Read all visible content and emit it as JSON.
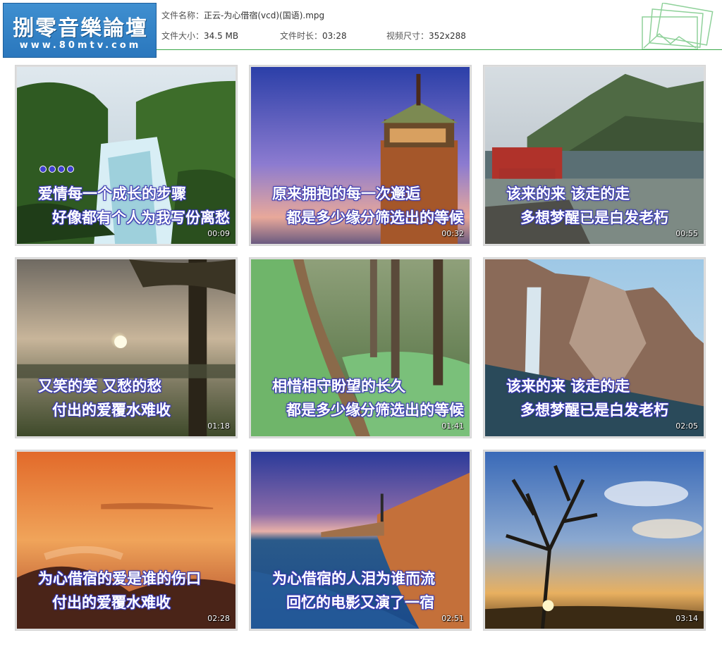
{
  "header": {
    "logo_title": "捌零音樂論壇",
    "logo_url": "www.80mtv.com",
    "file_name_label": "文件名称：",
    "file_name": "正云-为心借宿(vcd)(国语).mpg",
    "file_size_label": "文件大小：",
    "file_size": "34.5 MB",
    "duration_label": "文件时长：",
    "duration": "03:28",
    "resolution_label": "视频尺寸：",
    "resolution": "352x288",
    "accent_color": "#3aa84a"
  },
  "thumbnails": [
    {
      "scene": "waterfall-forest",
      "top": "爱情每一个成长的步骤",
      "bottom": "好像都有个人为我写份离愁",
      "time": "00:09",
      "dots": true
    },
    {
      "scene": "tower-dusk",
      "top": "原来拥抱的每一次邂逅",
      "bottom": "都是多少缘分筛选出的等候",
      "time": "00:32"
    },
    {
      "scene": "fjord-village",
      "top": "该来的来 该走的走",
      "bottom": "多想梦醒已是白发老朽",
      "time": "00:55"
    },
    {
      "scene": "misty-sunset",
      "top": "又笑的笑 又愁的愁",
      "bottom": "付出的爱覆水难收",
      "time": "01:18"
    },
    {
      "scene": "forest-path",
      "top": "相惜相守盼望的长久",
      "bottom": "都是多少缘分筛选出的等候",
      "time": "01:41"
    },
    {
      "scene": "mountain-falls",
      "top": "该来的来 该走的走",
      "bottom": "多想梦醒已是白发老朽",
      "time": "02:05"
    },
    {
      "scene": "orange-sky",
      "top": "为心借宿的爱是谁的伤口",
      "bottom": "付出的爱覆水难收",
      "time": "02:28"
    },
    {
      "scene": "coast-cliff",
      "top": "为心借宿的人泪为谁而流",
      "bottom": "回忆的电影又演了一宿",
      "time": "02:51"
    },
    {
      "scene": "tree-sunset",
      "top": "",
      "bottom": "",
      "time": "03:14"
    }
  ]
}
